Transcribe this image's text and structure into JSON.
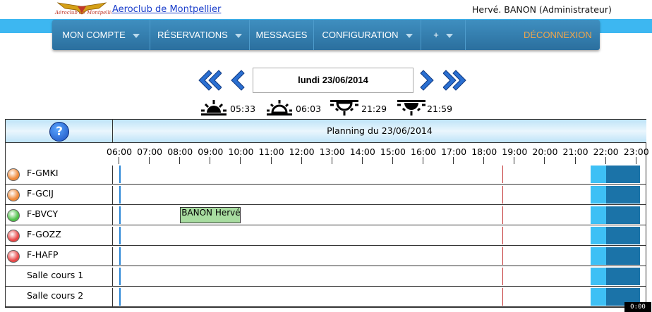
{
  "header": {
    "logo_text": "Aéroclub de Montpellier",
    "site_link": "Aeroclub de Montpellier",
    "user": "Hervé. BANON (Administrateur)"
  },
  "nav": {
    "items": [
      {
        "label": "MON COMPTE",
        "has_caret": true
      },
      {
        "label": "RÉSERVATIONS",
        "has_caret": true
      },
      {
        "label": "MESSAGES",
        "has_caret": false
      },
      {
        "label": "CONFIGURATION",
        "has_caret": true
      },
      {
        "label": "+",
        "has_caret": true
      }
    ],
    "logout": "DÉCONNEXION"
  },
  "date": {
    "current": "lundi 23/06/2014"
  },
  "sun": {
    "dawn": "05:33",
    "sunrise": "06:03",
    "sunset": "21:29",
    "dusk": "21:59"
  },
  "planning": {
    "title": "Planning du 23/06/2014",
    "hours": [
      "06:00",
      "07:00",
      "08:00",
      "09:00",
      "10:00",
      "11:00",
      "12:00",
      "13:00",
      "14:00",
      "15:00",
      "16:00",
      "17:00",
      "18:00",
      "19:00",
      "20:00",
      "21:00",
      "22:00",
      "23:00"
    ],
    "resources": [
      {
        "name": "F-GMKI",
        "status_color": "#f08a3a"
      },
      {
        "name": "F-GCIJ",
        "status_color": "#f08a3a"
      },
      {
        "name": "F-BVCY",
        "status_color": "#4fc24a"
      },
      {
        "name": "F-GOZZ",
        "status_color": "#e84848"
      },
      {
        "name": "F-HAFP",
        "status_color": "#e84848"
      },
      {
        "name": "Salle cours 1",
        "status_color": ""
      },
      {
        "name": "Salle cours 2",
        "status_color": ""
      }
    ],
    "reservations": [
      {
        "resource": "F-BVCY",
        "label": "BANON Hervé.",
        "start_hour": 8.0,
        "end_hour": 10.0
      }
    ],
    "current_time_hour": 18.6,
    "civil_dusk_start_hour": 21.5,
    "night_start_hour": 22.0
  },
  "timer": "0:00",
  "colors": {
    "top_band": "#3db7f1",
    "nav_bg": "#2b6f9e",
    "logout": "#f2a64a",
    "reservation": "#a8dca0"
  }
}
